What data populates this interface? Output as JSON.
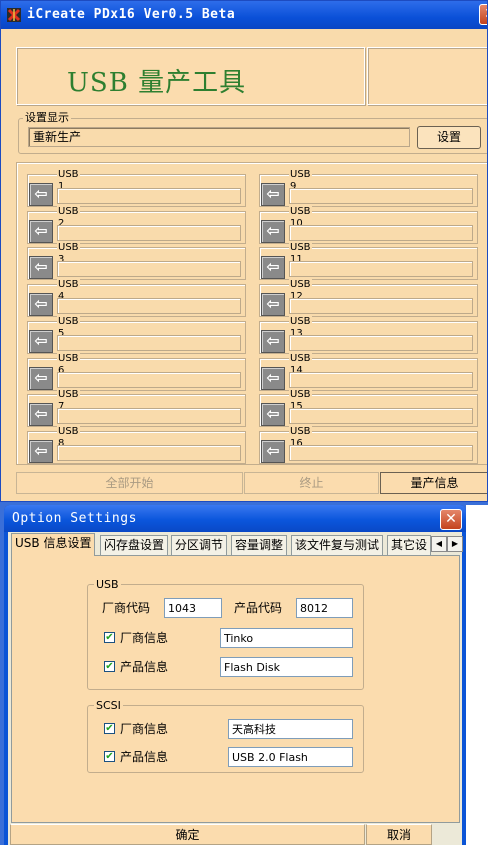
{
  "main_window": {
    "title": "iCreate PDx16 Ver0.5 Beta",
    "close_glyph": "✕",
    "header_title": "USB 量产工具",
    "settings_group_label": "设置显示",
    "settings_value": "重新生产",
    "settings_button": "设置",
    "arrow_glyph": "⇦",
    "usb_slots": [
      "USB 1",
      "USB 2",
      "USB 3",
      "USB 4",
      "USB 5",
      "USB 6",
      "USB 7",
      "USB 8",
      "USB 9",
      "USB 10",
      "USB 11",
      "USB 12",
      "USB 13",
      "USB 14",
      "USB 15",
      "USB 16"
    ],
    "start_all_button": "全部开始",
    "stop_button": "终止",
    "info_button": "量产信息"
  },
  "option_window": {
    "title": "Option Settings",
    "close_glyph": "✕",
    "tabs": [
      "USB 信息设置",
      "闪存盘设置",
      "分区调节",
      "容量调整",
      "该文件复与测试",
      "其它设"
    ],
    "tab_scroll_left": "◀",
    "tab_scroll_right": "▶",
    "usb_group": {
      "label": "USB",
      "vendor_code_label": "厂商代码",
      "vendor_code_value": "1043",
      "product_code_label": "产品代码",
      "product_code_value": "8012",
      "vendor_info_label": "厂商信息",
      "vendor_info_value": "Tinko",
      "vendor_info_checked": true,
      "product_info_label": "产品信息",
      "product_info_value": "Flash Disk",
      "product_info_checked": true
    },
    "scsi_group": {
      "label": "SCSI",
      "vendor_info_label": "厂商信息",
      "vendor_info_value": "天高科技",
      "vendor_info_checked": true,
      "product_info_label": "产品信息",
      "product_info_value": "USB 2.0 Flash",
      "product_info_checked": true
    },
    "check_glyph": "✔",
    "ok_button": "确定",
    "cancel_button": "取消"
  },
  "colors": {
    "window_bg": "#f9dbac",
    "titlebar": "#0a50d8",
    "header_text": "#2e7f30",
    "desktop": "#3a6fd8"
  }
}
